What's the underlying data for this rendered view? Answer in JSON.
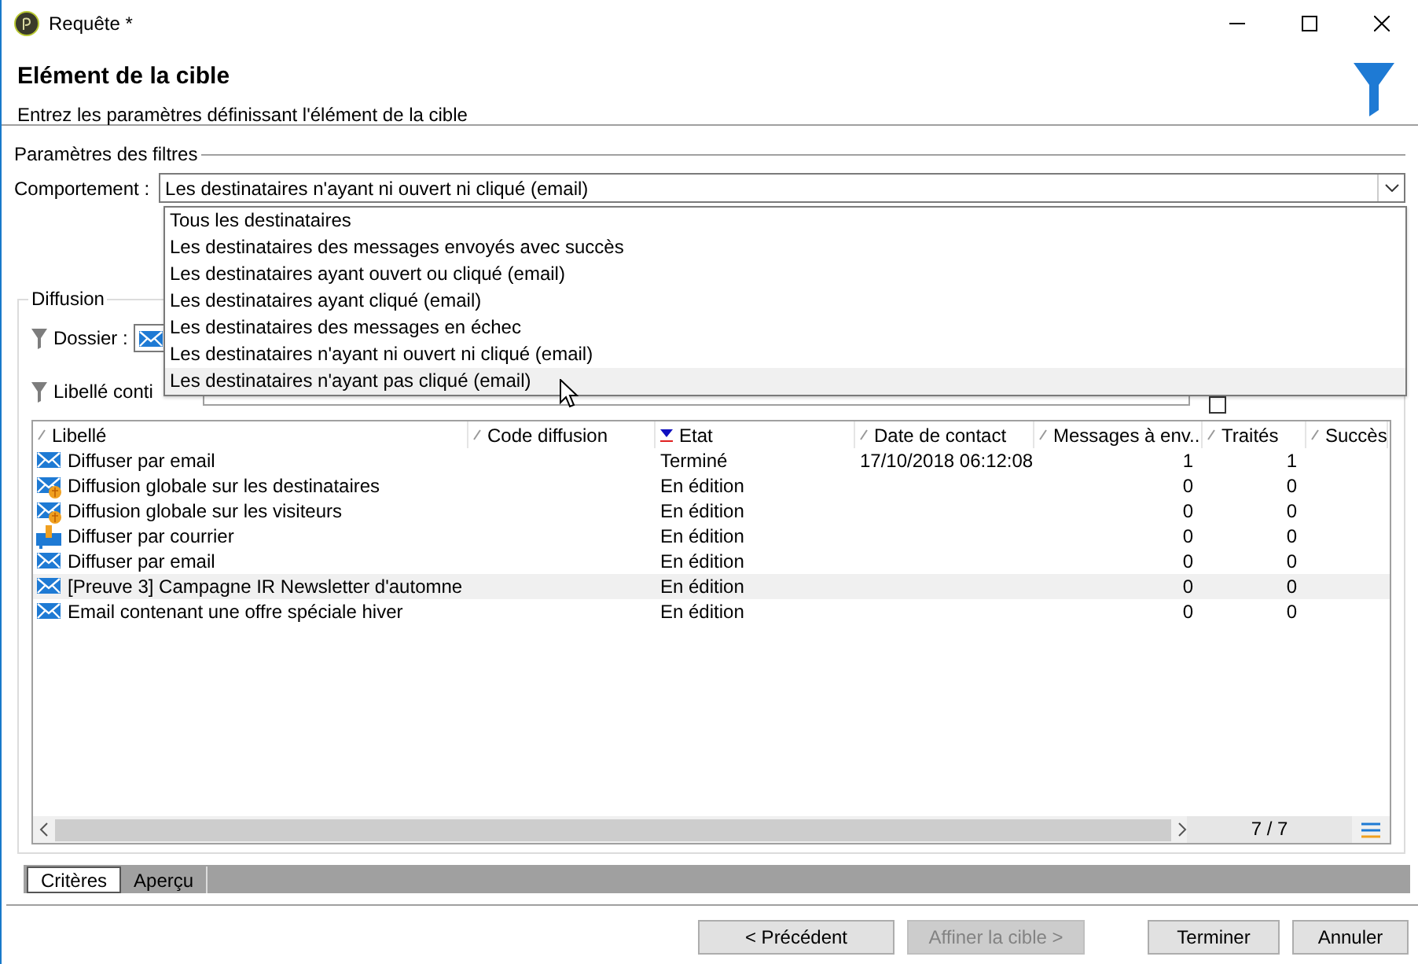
{
  "window": {
    "title": "Requête *"
  },
  "header": {
    "title": "Elément de la cible",
    "subtitle": "Entrez les paramètres définissant l'élément de la cible"
  },
  "filters": {
    "legend": "Paramètres des filtres",
    "behavior_label": "Comportement :",
    "behavior_value": "Les destinataires n'ayant ni ouvert ni cliqué (email)"
  },
  "dropdown": {
    "options": [
      {
        "label": "Tous les destinataires",
        "highlighted": false
      },
      {
        "label": "Les destinataires des messages envoyés avec succès",
        "highlighted": false
      },
      {
        "label": "Les destinataires ayant ouvert ou cliqué (email)",
        "highlighted": false
      },
      {
        "label": "Les destinataires ayant cliqué (email)",
        "highlighted": false
      },
      {
        "label": "Les destinataires des messages en échec",
        "highlighted": false
      },
      {
        "label": "Les destinataires n'ayant ni ouvert ni cliqué (email)",
        "highlighted": false
      },
      {
        "label": "Les destinataires n'ayant pas cliqué (email)",
        "highlighted": true
      }
    ]
  },
  "diffusion": {
    "legend": "Diffusion",
    "folder_label": "Dossier :",
    "label_filter_label": "Libellé conti",
    "show_checkbox": {
      "checked": false
    }
  },
  "table": {
    "columns": [
      {
        "label": "Libellé",
        "sorted": false
      },
      {
        "label": "Code diffusion",
        "sorted": false
      },
      {
        "label": "Etat",
        "sorted": true
      },
      {
        "label": "Date de contact",
        "sorted": false
      },
      {
        "label": "Messages à env...",
        "sorted": false
      },
      {
        "label": "Traités",
        "sorted": false
      },
      {
        "label": "Succès",
        "sorted": false
      }
    ],
    "rows": [
      {
        "kind": "email",
        "selected": false,
        "cells": [
          "Diffuser par email",
          "",
          "Terminé",
          "17/10/2018 06:12:08",
          "1",
          "1",
          ""
        ]
      },
      {
        "kind": "web",
        "selected": false,
        "cells": [
          "Diffusion globale sur les destinataires",
          "",
          "En édition",
          "",
          "0",
          "0",
          ""
        ]
      },
      {
        "kind": "web",
        "selected": false,
        "cells": [
          "Diffusion globale sur les visiteurs",
          "",
          "En édition",
          "",
          "0",
          "0",
          ""
        ]
      },
      {
        "kind": "mail",
        "selected": false,
        "cells": [
          "Diffuser par courrier",
          "",
          "En édition",
          "",
          "0",
          "0",
          ""
        ]
      },
      {
        "kind": "email",
        "selected": false,
        "cells": [
          "Diffuser par email",
          "",
          "En édition",
          "",
          "0",
          "0",
          ""
        ]
      },
      {
        "kind": "email",
        "selected": true,
        "cells": [
          "[Preuve 3] Campagne IR Newsletter d'automne",
          "",
          "En édition",
          "",
          "0",
          "0",
          ""
        ]
      },
      {
        "kind": "email",
        "selected": false,
        "cells": [
          "Email contenant une offre spéciale hiver",
          "",
          "En édition",
          "",
          "0",
          "0",
          ""
        ]
      }
    ],
    "count": "7 / 7"
  },
  "tabs": [
    {
      "label": "Critères",
      "selected": true
    },
    {
      "label": "Aperçu",
      "selected": false
    }
  ],
  "buttons": [
    {
      "label": "< Précédent",
      "disabled": false
    },
    {
      "label": "Affiner la cible >",
      "disabled": true
    },
    {
      "label": "Terminer",
      "disabled": false
    },
    {
      "label": "Annuler",
      "disabled": false
    }
  ]
}
